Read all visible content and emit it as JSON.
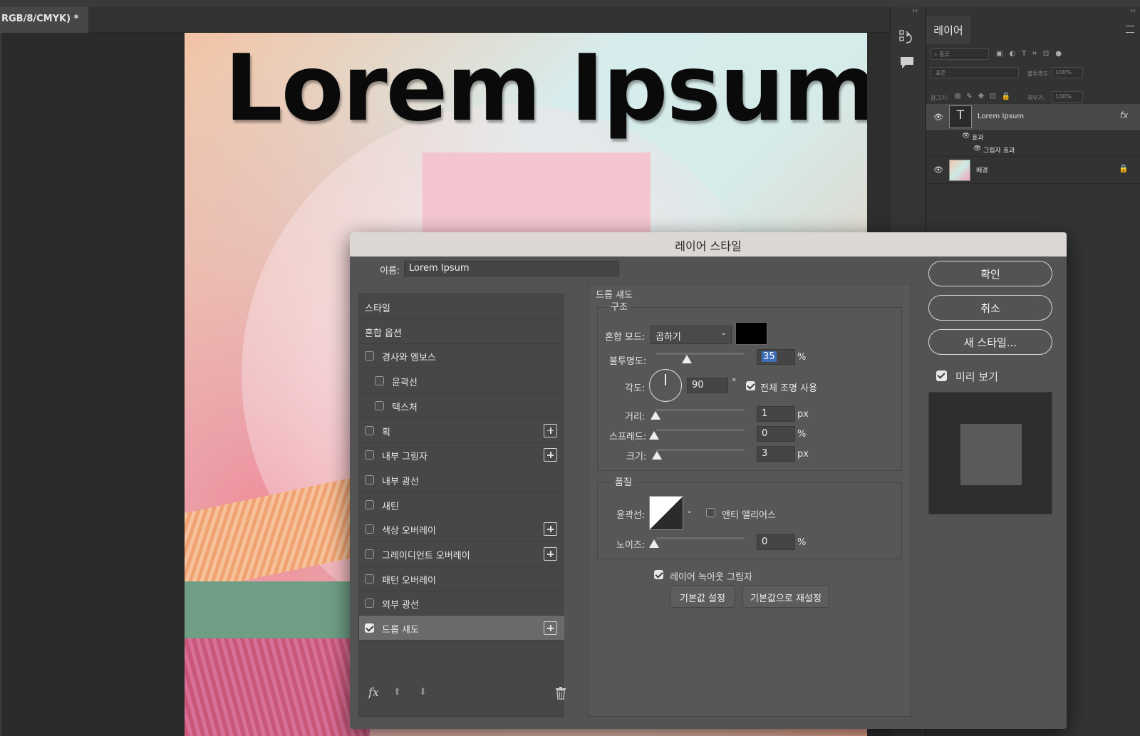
{
  "document": {
    "tab_title": "RGB/8/CMYK) *"
  },
  "canvas": {
    "headline": "Lorem Ipsum"
  },
  "layers_panel": {
    "tab": "레이어",
    "search_placeholder": "종류",
    "blend_value": "표준",
    "opacity_label": "불투명도:",
    "opacity_value": "100%",
    "lock_label": "잠그기:",
    "fill_label": "채우기:",
    "fill_value": "100%",
    "layers": [
      {
        "name": "Lorem Ipsum",
        "type": "text"
      },
      {
        "name": "효과"
      },
      {
        "name": "그림자 효과"
      },
      {
        "name": "배경"
      }
    ]
  },
  "dialog": {
    "title": "레이어 스타일",
    "name_label": "이름:",
    "name_value": "Lorem Ipsum",
    "styles": [
      {
        "label": "스타일",
        "checkbox": false,
        "plus": false,
        "indent": false
      },
      {
        "label": "혼합 옵션",
        "checkbox": false,
        "plus": false,
        "indent": false
      },
      {
        "label": "경사와 엠보스",
        "checkbox": true,
        "checked": false,
        "plus": false,
        "indent": false
      },
      {
        "label": "윤곽선",
        "checkbox": true,
        "checked": false,
        "plus": false,
        "indent": true
      },
      {
        "label": "텍스처",
        "checkbox": true,
        "checked": false,
        "plus": false,
        "indent": true
      },
      {
        "label": "획",
        "checkbox": true,
        "checked": false,
        "plus": true,
        "indent": false
      },
      {
        "label": "내부 그림자",
        "checkbox": true,
        "checked": false,
        "plus": true,
        "indent": false
      },
      {
        "label": "내부 광선",
        "checkbox": true,
        "checked": false,
        "plus": false,
        "indent": false
      },
      {
        "label": "새틴",
        "checkbox": true,
        "checked": false,
        "plus": false,
        "indent": false
      },
      {
        "label": "색상 오버레이",
        "checkbox": true,
        "checked": false,
        "plus": true,
        "indent": false
      },
      {
        "label": "그레이디언트 오버레이",
        "checkbox": true,
        "checked": false,
        "plus": true,
        "indent": false
      },
      {
        "label": "패턴 오버레이",
        "checkbox": true,
        "checked": false,
        "plus": false,
        "indent": false
      },
      {
        "label": "외부 광선",
        "checkbox": true,
        "checked": false,
        "plus": false,
        "indent": false
      },
      {
        "label": "드롭 섀도",
        "checkbox": true,
        "checked": true,
        "plus": true,
        "indent": false,
        "active": true
      }
    ],
    "footer_fx": "fx",
    "section_title": "드롭 섀도",
    "structure": {
      "title": "구조",
      "blend_mode_label": "혼합 모드:",
      "blend_mode_value": "곱하기",
      "shadow_color": "#000000",
      "opacity_label": "불투명도:",
      "opacity_value": "35",
      "opacity_unit": "%",
      "angle_label": "각도:",
      "angle_value": "90",
      "angle_unit": "°",
      "global_light_label": "전체 조명 사용",
      "global_light_checked": true,
      "distance_label": "거리:",
      "distance_value": "1",
      "distance_unit": "px",
      "spread_label": "스프레드:",
      "spread_value": "0",
      "spread_unit": "%",
      "size_label": "크기:",
      "size_value": "3",
      "size_unit": "px"
    },
    "quality": {
      "title": "품질",
      "contour_label": "윤곽선:",
      "antialias_label": "앤티 앨리어스",
      "antialias_checked": false,
      "noise_label": "노이즈:",
      "noise_value": "0",
      "noise_unit": "%"
    },
    "knockout_label": "레이어 녹아웃 그림자",
    "knockout_checked": true,
    "set_default_label": "기본값 설정",
    "reset_default_label": "기본값으로 재설정",
    "ok_label": "확인",
    "cancel_label": "취소",
    "new_style_label": "새 스타일...",
    "preview_label": "미리 보기",
    "preview_checked": true
  }
}
